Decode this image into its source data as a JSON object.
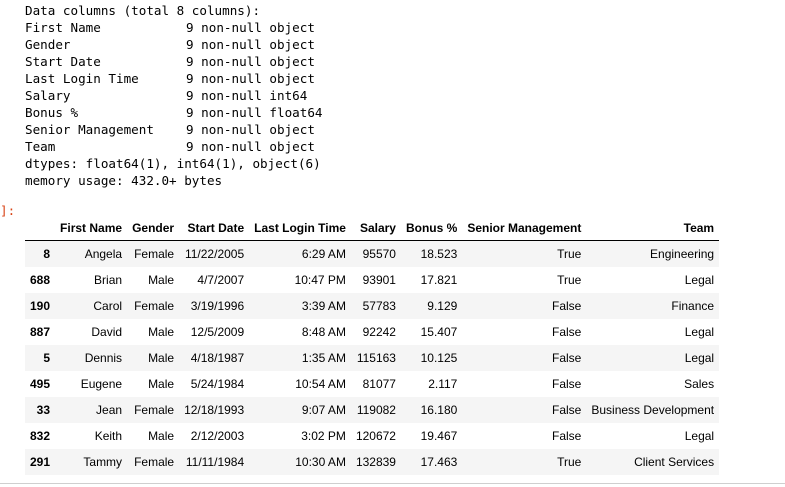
{
  "info_output": {
    "header": "Data columns (total 8 columns):",
    "columns": [
      {
        "name": "First Name",
        "info": "9 non-null object"
      },
      {
        "name": "Gender",
        "info": "9 non-null object"
      },
      {
        "name": "Start Date",
        "info": "9 non-null object"
      },
      {
        "name": "Last Login Time",
        "info": "9 non-null object"
      },
      {
        "name": "Salary",
        "info": "9 non-null int64"
      },
      {
        "name": "Bonus %",
        "info": "9 non-null float64"
      },
      {
        "name": "Senior Management",
        "info": "9 non-null object"
      },
      {
        "name": "Team",
        "info": "9 non-null object"
      }
    ],
    "dtypes": "dtypes: float64(1), int64(1), object(6)",
    "memory": "memory usage: 432.0+ bytes"
  },
  "cell": {
    "prompt": "]:"
  },
  "dataframe": {
    "headers": [
      "",
      "First Name",
      "Gender",
      "Start Date",
      "Last Login Time",
      "Salary",
      "Bonus %",
      "Senior Management",
      "Team"
    ],
    "rows": [
      [
        "8",
        "Angela",
        "Female",
        "11/22/2005",
        "6:29 AM",
        "95570",
        "18.523",
        "True",
        "Engineering"
      ],
      [
        "688",
        "Brian",
        "Male",
        "4/7/2007",
        "10:47 PM",
        "93901",
        "17.821",
        "True",
        "Legal"
      ],
      [
        "190",
        "Carol",
        "Female",
        "3/19/1996",
        "3:39 AM",
        "57783",
        "9.129",
        "False",
        "Finance"
      ],
      [
        "887",
        "David",
        "Male",
        "12/5/2009",
        "8:48 AM",
        "92242",
        "15.407",
        "False",
        "Legal"
      ],
      [
        "5",
        "Dennis",
        "Male",
        "4/18/1987",
        "1:35 AM",
        "115163",
        "10.125",
        "False",
        "Legal"
      ],
      [
        "495",
        "Eugene",
        "Male",
        "5/24/1984",
        "10:54 AM",
        "81077",
        "2.117",
        "False",
        "Sales"
      ],
      [
        "33",
        "Jean",
        "Female",
        "12/18/1993",
        "9:07 AM",
        "119082",
        "16.180",
        "False",
        "Business Development"
      ],
      [
        "832",
        "Keith",
        "Male",
        "2/12/2003",
        "3:02 PM",
        "120672",
        "19.467",
        "False",
        "Legal"
      ],
      [
        "291",
        "Tammy",
        "Female",
        "11/11/1984",
        "10:30 AM",
        "132839",
        "17.463",
        "True",
        "Client Services"
      ]
    ]
  }
}
